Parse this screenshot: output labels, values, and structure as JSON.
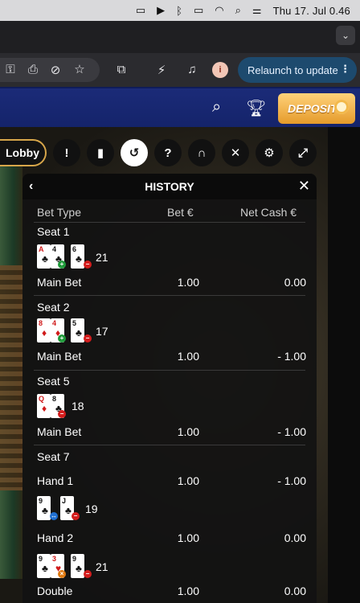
{
  "menubar": {
    "clock": "Thu 17. Jul  0.46",
    "icons": [
      "display-icon",
      "play-icon",
      "bluetooth-icon",
      "battery-icon",
      "wifi-icon",
      "search-icon",
      "control-center-icon"
    ]
  },
  "browser": {
    "relaunch_label": "Relaunch to update",
    "avatar_letter": "i"
  },
  "site_header": {
    "deposit_label": "DEPOSIT"
  },
  "game_toolbar": {
    "lobby_label": "Lobby"
  },
  "history": {
    "title": "HISTORY",
    "columns": {
      "bet_type": "Bet Type",
      "bet": "Bet €",
      "net": "Net Cash €"
    },
    "seat1": {
      "label": "Seat 1",
      "total": "21",
      "bet_label": "Main Bet",
      "bet": "1.00",
      "net": "0.00"
    },
    "seat2": {
      "label": "Seat 2",
      "total": "17",
      "bet_label": "Main Bet",
      "bet": "1.00",
      "net": "- 1.00"
    },
    "seat5": {
      "label": "Seat 5",
      "total": "18",
      "bet_label": "Main Bet",
      "bet": "1.00",
      "net": "- 1.00"
    },
    "seat7": {
      "label": "Seat 7",
      "hand1": {
        "label": "Hand 1",
        "bet": "1.00",
        "net": "- 1.00",
        "total": "19"
      },
      "hand2": {
        "label": "Hand 2",
        "bet": "1.00",
        "net": "0.00",
        "total": "21"
      },
      "double": {
        "label": "Double",
        "bet": "1.00",
        "net": "0.00"
      }
    }
  },
  "cards": {
    "seat1_a": [
      "A",
      "♣",
      "4",
      "♣"
    ],
    "seat1_b": [
      "6",
      "♣"
    ],
    "seat2_a": [
      "8",
      "♦",
      "4",
      "♦"
    ],
    "seat2_b": [
      "5",
      "♣"
    ],
    "seat5_a": [
      "Q",
      "♦",
      "8",
      "♣"
    ],
    "h1_a": [
      "9",
      "♣"
    ],
    "h1_b": [
      "J",
      "♣"
    ],
    "h2_a": [
      "9",
      "♣",
      "3",
      "♥"
    ],
    "h2_b": [
      "9",
      "♣"
    ]
  },
  "colors": {
    "header_blue": "#1b2b78",
    "deposit_gold": "#f0b545",
    "relaunch_bg": "#1d4a6e",
    "panel_bg": "#121212",
    "badge_green": "#1f9a3a",
    "badge_red": "#d31d1d"
  }
}
